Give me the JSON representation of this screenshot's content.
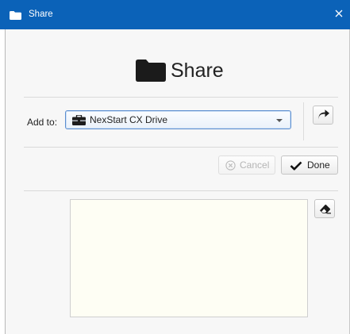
{
  "window": {
    "title": "Share",
    "close_icon": "close-icon",
    "folder_icon": "folder-icon"
  },
  "header": {
    "heading": "Share",
    "icon": "folder-icon"
  },
  "add_to": {
    "label": "Add to:",
    "selected": "NexStart CX Drive",
    "option_icon": "briefcase-icon"
  },
  "actions": {
    "share_icon": "share-arrow-icon",
    "cancel_label": "Cancel",
    "done_label": "Done",
    "cancel_enabled": false
  },
  "notes": {
    "value": "",
    "clear_icon": "eraser-icon"
  },
  "colors": {
    "titlebar": "#0b62b8",
    "notes_bg": "#fefef4",
    "focus_border": "#5b8ed0"
  }
}
